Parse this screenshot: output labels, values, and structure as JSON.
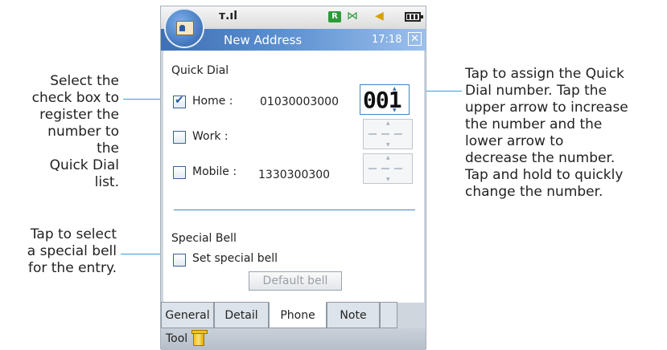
{
  "callouts": {
    "checkbox": [
      "Select the",
      "check box to",
      "register the",
      "number to the",
      "Quick Dial list."
    ],
    "bell": [
      "Tap to select",
      "a special bell",
      "for the entry."
    ],
    "quickdial": [
      "Tap to assign the Quick",
      "Dial number. Tap the",
      "upper arrow to increase",
      "the number and the",
      "lower arrow to",
      "decrease the number.",
      "Tap and hold to quickly",
      "change the number."
    ]
  },
  "status": {
    "roaming": "R",
    "signal_icon": "signal-icon",
    "battery_icon": "battery-icon"
  },
  "title": {
    "text": "New Address",
    "time": "17:18",
    "close": "✕"
  },
  "quick_dial": {
    "heading": "Quick Dial",
    "rows": [
      {
        "label": "Home :",
        "number": "01030003000",
        "checked": true,
        "dial": "001"
      },
      {
        "label": "Work :",
        "number": "",
        "checked": false,
        "dial": ""
      },
      {
        "label": "Mobile :",
        "number": "1330300300",
        "checked": false,
        "dial": ""
      }
    ]
  },
  "special_bell": {
    "heading": "Special Bell",
    "checkbox_label": "Set special bell",
    "checked": false,
    "button": "Default bell"
  },
  "tabs": [
    "General",
    "Detail",
    "Phone",
    "Note"
  ],
  "active_tab": "Phone",
  "toolbar": {
    "label": "Tool"
  }
}
